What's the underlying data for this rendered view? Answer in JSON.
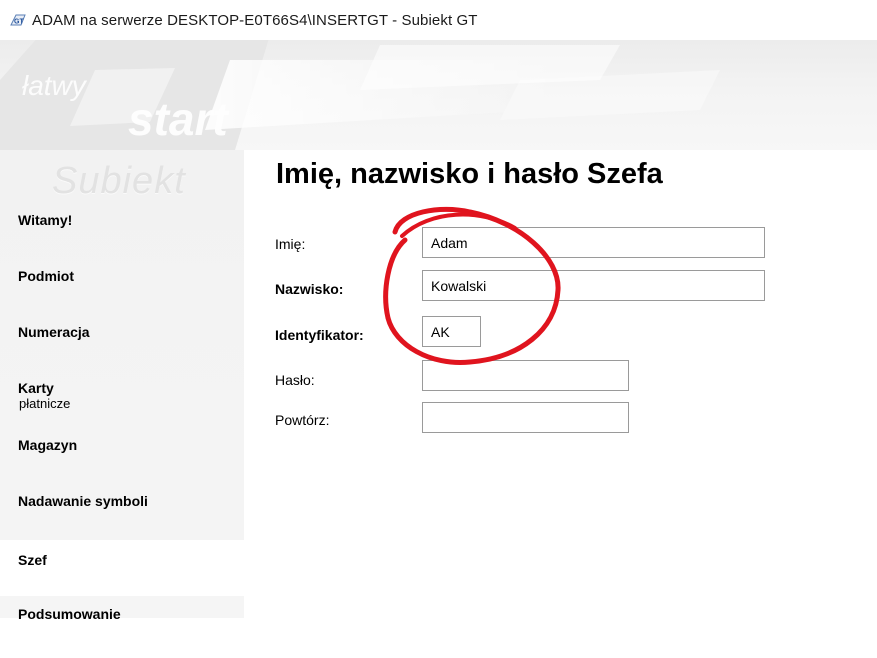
{
  "window": {
    "title": "ADAM na serwerze DESKTOP-E0T66S4\\INSERTGT - Subiekt GT",
    "icon": "subiekt-gt-icon"
  },
  "banner": {
    "tagline_word1": "łatwy",
    "tagline_word2": "start"
  },
  "sidebar": {
    "logo_text": "Subiekt",
    "items": [
      {
        "label": "Witamy!",
        "sub": ""
      },
      {
        "label": "Podmiot",
        "sub": ""
      },
      {
        "label": "Numeracja",
        "sub": ""
      },
      {
        "label": "Karty",
        "sub": "płatnicze"
      },
      {
        "label": "Magazyn",
        "sub": ""
      },
      {
        "label": "Nadawanie symboli",
        "sub": ""
      },
      {
        "label": "Szef",
        "sub": "",
        "active": true
      },
      {
        "label": "Podsumowanie",
        "sub": ""
      }
    ]
  },
  "main": {
    "title": "Imię, nazwisko i hasło Szefa",
    "fields": {
      "first_name": {
        "label": "Imię:",
        "value": "Adam"
      },
      "last_name": {
        "label": "Nazwisko:",
        "value": "Kowalski"
      },
      "identifier": {
        "label": "Identyfikator:",
        "value": "AK"
      },
      "password": {
        "label": "Hasło:",
        "value": ""
      },
      "repeat": {
        "label": "Powtórz:",
        "value": ""
      }
    }
  },
  "colors": {
    "annotation": "#e0141e",
    "active_bg": "#ffffff",
    "sidebar_bg": "#f2f2f2"
  }
}
